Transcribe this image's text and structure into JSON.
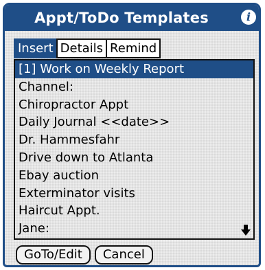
{
  "dialog": {
    "title": "Appt/ToDo Templates",
    "info_icon": "i"
  },
  "tabs": [
    {
      "label": "Insert",
      "active": true
    },
    {
      "label": "Details",
      "active": false
    },
    {
      "label": "Remind",
      "active": false
    }
  ],
  "list": {
    "items": [
      "[1] Work on Weekly Report",
      "Channel:",
      "Chiropractor Appt",
      "Daily Journal <<date>>",
      "Dr. Hammesfahr",
      "Drive down to Atlanta",
      "Ebay auction",
      "Exterminator visits",
      "Haircut Appt.",
      "Jane:"
    ],
    "selected_index": 0,
    "scroll_icon": "down-arrow-icon"
  },
  "buttons": {
    "goto_label": "GoTo/Edit",
    "cancel_label": "Cancel"
  },
  "colors": {
    "accent": "#1f4e87",
    "background": "#e4e4e4"
  }
}
